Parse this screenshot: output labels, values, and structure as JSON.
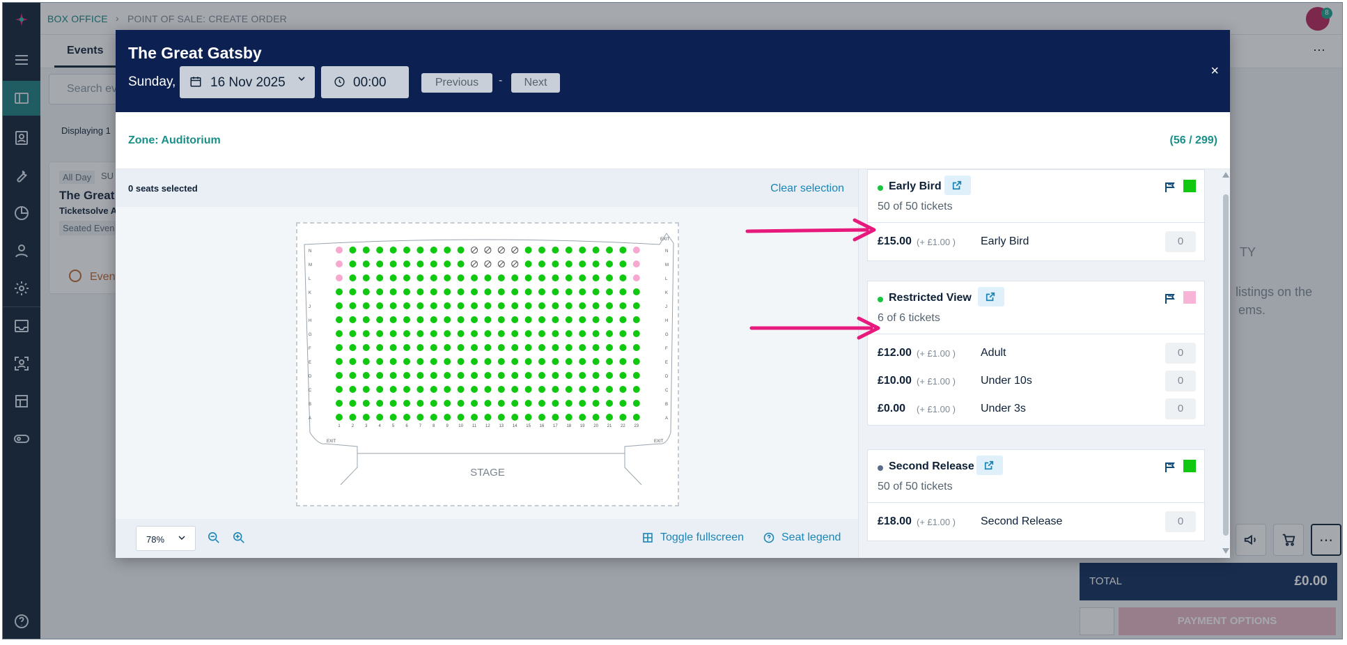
{
  "breadcrumbs": [
    "BOX OFFICE",
    "POINT OF SALE: CREATE ORDER"
  ],
  "notification_count": "8",
  "background": {
    "tab": "Events",
    "search_placeholder": "Search ev",
    "displaying": "Displaying 1",
    "card": {
      "chip": "All Day",
      "chip2": "SU",
      "title": "The Great",
      "org": "Ticketsolve A",
      "tag": "Seated Even",
      "event": "Event"
    },
    "right_text0": "TY",
    "right_text1": "listings on the",
    "right_text2": "ems.",
    "total_label": "TOTAL",
    "total_amount": "£0.00",
    "payment_label": "PAYMENT OPTIONS"
  },
  "modal": {
    "title": "The Great Gatsby",
    "day": "Sunday,",
    "date": "16 Nov 2025",
    "time": "00:00",
    "prev_label": "Previous",
    "dash": "-",
    "next_label": "Next",
    "close": "×",
    "zone_label": "Zone: Auditorium",
    "zone_count": "(56 / 299)",
    "seats_selected": "0 seats selected",
    "clear_selection": "Clear selection",
    "zoom": "78%",
    "toggle_fullscreen": "Toggle fullscreen",
    "seat_legend": "Seat legend",
    "stage_label": "STAGE",
    "exit_label": "EXIT",
    "row_labels": [
      "N",
      "M",
      "L",
      "K",
      "J",
      "H",
      "G",
      "F",
      "E",
      "D",
      "C",
      "B",
      "A"
    ],
    "seat_numbers": [
      "1",
      "2",
      "3",
      "4",
      "5",
      "6",
      "7",
      "8",
      "9",
      "10",
      "11",
      "12",
      "13",
      "14",
      "15",
      "16",
      "17",
      "18",
      "19",
      "20",
      "21",
      "22",
      "23"
    ]
  },
  "price_bands": [
    {
      "name": "Early Bird",
      "tickets": "50 of 50 tickets",
      "dot_color": "#17c53c",
      "swatch_color": "#10c810",
      "prices": [
        {
          "amount": "£15.00",
          "fee": "(+ £1.00 )",
          "name": "Early Bird",
          "qty": "0"
        }
      ]
    },
    {
      "name": "Restricted View",
      "tickets": "6 of 6 tickets",
      "dot_color": "#17c53c",
      "swatch_color": "#f7b4d6",
      "prices": [
        {
          "amount": "£12.00",
          "fee": "(+ £1.00 )",
          "name": "Adult",
          "qty": "0"
        },
        {
          "amount": "£10.00",
          "fee": "(+ £1.00 )",
          "name": "Under 10s",
          "qty": "0"
        },
        {
          "amount": "£0.00",
          "fee": "(+ £1.00 )",
          "name": "Under 3s",
          "qty": "0"
        }
      ]
    },
    {
      "name": "Second Release",
      "tickets": "50 of 50 tickets",
      "dot_color": "#5d6b8a",
      "swatch_color": "#10c810",
      "prices": [
        {
          "amount": "£18.00",
          "fee": "(+ £1.00 )",
          "name": "Second Release",
          "qty": "0"
        }
      ]
    }
  ],
  "colors": {
    "available_seat": "#10c810",
    "restricted_seat": "#f7a8cf",
    "accent": "#1a8f88",
    "arrow": "#e8197c",
    "header": "#0d2052"
  }
}
